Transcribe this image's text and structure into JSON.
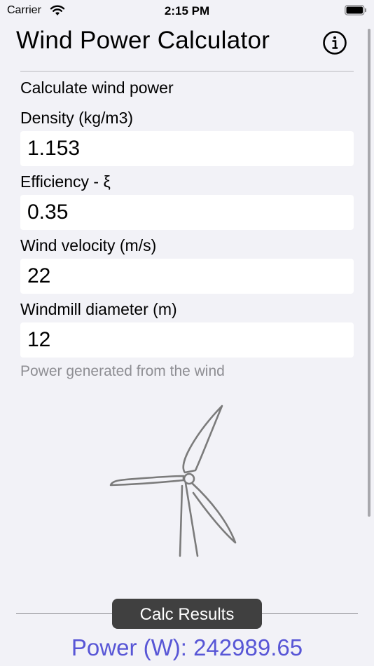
{
  "status_bar": {
    "carrier": "Carrier",
    "time": "2:15 PM"
  },
  "header": {
    "title": "Wind Power Calculator"
  },
  "form": {
    "section_title": "Calculate wind power",
    "fields": [
      {
        "label": "Density (kg/m3)",
        "value": "1.153"
      },
      {
        "label": "Efficiency - ξ",
        "value": "0.35"
      },
      {
        "label": "Wind velocity (m/s)",
        "value": "22"
      },
      {
        "label": "Windmill diameter (m)",
        "value": "12"
      }
    ],
    "hint": "Power generated from the wind"
  },
  "footer": {
    "calc_label": "Calc Results",
    "result": "Power (W): 242989.65"
  },
  "colors": {
    "accent": "#5856d6",
    "button_bg": "#404040",
    "background": "#f2f2f7"
  }
}
